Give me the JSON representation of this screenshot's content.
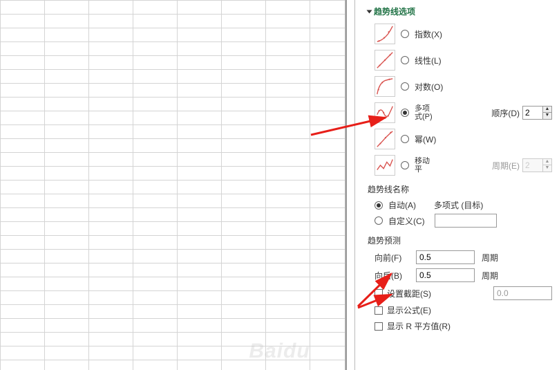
{
  "section_title": "趋势线选项",
  "options": {
    "exponential": {
      "label": "指数(X)"
    },
    "linear": {
      "label": "线性(L)"
    },
    "logarithmic": {
      "label": "对数(O)"
    },
    "polynomial": {
      "label_top": "多项",
      "label_bot": "式(P)",
      "order_label": "顺序(D)",
      "order_value": "2"
    },
    "power": {
      "label": "幂(W)"
    },
    "moving_avg": {
      "label_top": "移动",
      "label_bot": "平",
      "period_label": "周期(E)",
      "period_value": "2"
    }
  },
  "name_section": {
    "title": "趋势线名称",
    "auto_label": "自动(A)",
    "auto_value": "多项式 (目标)",
    "custom_label": "自定义(C)",
    "custom_value": ""
  },
  "forecast": {
    "title": "趋势预测",
    "forward_label": "向前(F)",
    "forward_value": "0.5",
    "backward_label": "向后(B)",
    "backward_value": "0.5",
    "unit": "周期"
  },
  "checks": {
    "intercept_label": "设置截距(S)",
    "intercept_value": "0.0",
    "equation_label": "显示公式(E)",
    "rsquared_label": "显示 R 平方值(R)"
  },
  "watermark": "Baidu"
}
